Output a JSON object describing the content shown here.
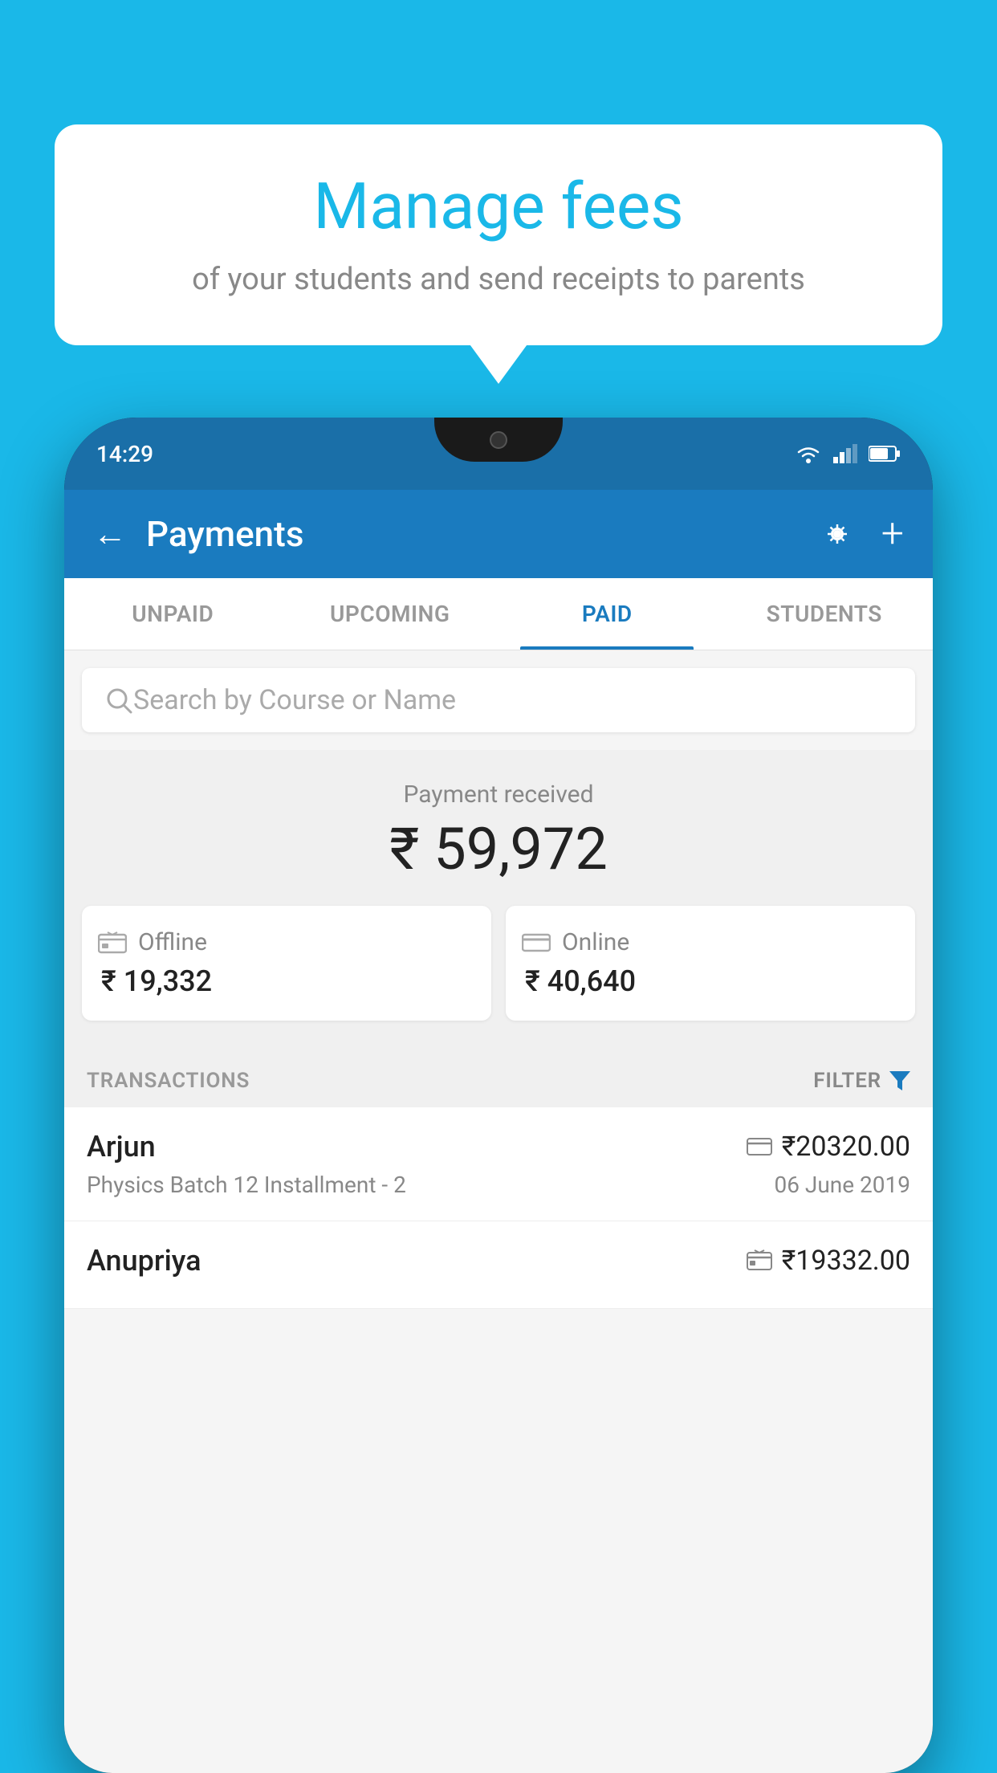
{
  "background_color": "#1ab8e8",
  "speech_bubble": {
    "title": "Manage fees",
    "subtitle": "of your students and send receipts to parents"
  },
  "status_bar": {
    "time": "14:29"
  },
  "app_bar": {
    "title": "Payments",
    "back_label": "←",
    "plus_label": "+"
  },
  "tabs": [
    {
      "label": "UNPAID",
      "active": false
    },
    {
      "label": "UPCOMING",
      "active": false
    },
    {
      "label": "PAID",
      "active": true
    },
    {
      "label": "STUDENTS",
      "active": false
    }
  ],
  "search": {
    "placeholder": "Search by Course or Name"
  },
  "payment_section": {
    "label": "Payment received",
    "total_amount": "₹ 59,972",
    "offline": {
      "label": "Offline",
      "amount": "₹ 19,332"
    },
    "online": {
      "label": "Online",
      "amount": "₹ 40,640"
    }
  },
  "transactions": {
    "header": "TRANSACTIONS",
    "filter_label": "FILTER",
    "rows": [
      {
        "name": "Arjun",
        "course": "Physics Batch 12 Installment - 2",
        "amount": "₹20320.00",
        "date": "06 June 2019",
        "payment_type": "card"
      },
      {
        "name": "Anupriya",
        "course": "",
        "amount": "₹19332.00",
        "date": "",
        "payment_type": "offline"
      }
    ]
  }
}
